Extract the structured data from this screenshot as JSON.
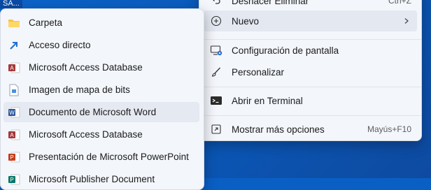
{
  "desktop": {
    "label": "SA..."
  },
  "context_menu": {
    "items": [
      {
        "label": "Deshacer Eliminar",
        "shortcut": "Ctrl+Z",
        "icon": "undo-icon"
      },
      {
        "label": "Nuevo",
        "icon": "new-plus-icon",
        "has_submenu": true
      },
      {
        "label": "Configuración de pantalla",
        "icon": "display-settings-icon"
      },
      {
        "label": "Personalizar",
        "icon": "brush-icon"
      },
      {
        "label": "Abrir en Terminal",
        "icon": "terminal-icon"
      },
      {
        "label": "Mostrar más opciones",
        "shortcut": "Mayús+F10",
        "icon": "more-options-icon"
      }
    ]
  },
  "submenu": {
    "items": [
      {
        "label": "Carpeta",
        "icon": "folder-icon"
      },
      {
        "label": "Acceso directo",
        "icon": "shortcut-arrow-icon"
      },
      {
        "label": "Microsoft Access Database",
        "icon": "access-icon"
      },
      {
        "label": "Imagen de mapa de bits",
        "icon": "bitmap-icon"
      },
      {
        "label": "Documento de Microsoft Word",
        "icon": "word-icon"
      },
      {
        "label": "Microsoft Access Database",
        "icon": "access-icon"
      },
      {
        "label": "Presentación de Microsoft PowerPoint",
        "icon": "powerpoint-icon"
      },
      {
        "label": "Microsoft Publisher Document",
        "icon": "publisher-icon"
      }
    ]
  },
  "colors": {
    "desktop": "#0b63c9",
    "menu_bg": "#f3f6fb",
    "hover": "#e3e8f1"
  }
}
